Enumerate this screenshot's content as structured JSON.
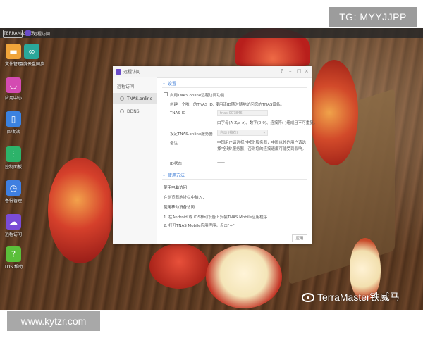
{
  "watermarks": {
    "telegram": "TG: MYYJJPP",
    "site": "www.kytzr.com",
    "weibo": "TerraMaster铁威马"
  },
  "taskbar": {
    "logo_text": "TERRAMASTER",
    "open_app": "远程访问"
  },
  "desktop_icons": [
    {
      "label": "文件管理",
      "icon": "folder-icon",
      "color": "#f0a43a"
    },
    {
      "label": "百度云盘同步",
      "icon": "cloud-sync-icon",
      "color": "#2aa89a"
    },
    {
      "label": "应用中心",
      "icon": "shopping-bag-icon",
      "color": "#d44bb2"
    },
    {
      "label": "回收站",
      "icon": "trash-icon",
      "color": "#3b82e0"
    },
    {
      "label": "控制面板",
      "icon": "sliders-icon",
      "color": "#2db36a"
    },
    {
      "label": "备份管理",
      "icon": "clock-icon",
      "color": "#3f7fe0"
    },
    {
      "label": "远程访问",
      "icon": "cloud-icon",
      "color": "#7a4cd6"
    },
    {
      "label": "TOS 帮助",
      "icon": "help-icon",
      "color": "#5bbf3a"
    }
  ],
  "window": {
    "title": "远程访问",
    "controls": [
      "?",
      "–",
      "□",
      "×"
    ],
    "sidebar": {
      "header": "远程访问",
      "items": [
        {
          "label": "TNAS.online",
          "active": true
        },
        {
          "label": "DDNS",
          "active": false
        }
      ]
    },
    "settings_section": "设置",
    "enable_checkbox_label": "启用TNAS.online远程访问功能",
    "description": "创建一个唯一的TNAS ID, 使用该ID随时随地访问您的TNAS设备。",
    "tnas_id_label": "TNAS ID",
    "tnas_id_placeholder": "tnas-007846",
    "tnas_id_hint": "由字母(A-Z/a-z)、数字(0-9)、连接符(-)组成且不可重复。",
    "server_label": "设定TNAS.online服务器",
    "server_value": "自动 (推荐)",
    "server_hint_label": "备注",
    "server_hint": "中国用户请选择\"中国\"服务器，中国以外的用户请选择\"全球\"服务器，否则您的连接速度可能受到影响。",
    "status_label": "ID状态",
    "status_value": "——",
    "usage_section": "使用方法",
    "pc_access_title": "使用电脑访问：",
    "pc_access_text": "在浏览器地址栏中输入：",
    "pc_access_value": "——",
    "mobile_access_title": "使用移动设备访问：",
    "mobile_step_1": "1. 在Android 或 iOS移动设备上安装TNAS Mobile应用程序",
    "mobile_step_2": "2. 打开TNAS Mobile应用程序，点击\"+\"",
    "apply_button": "应用"
  }
}
